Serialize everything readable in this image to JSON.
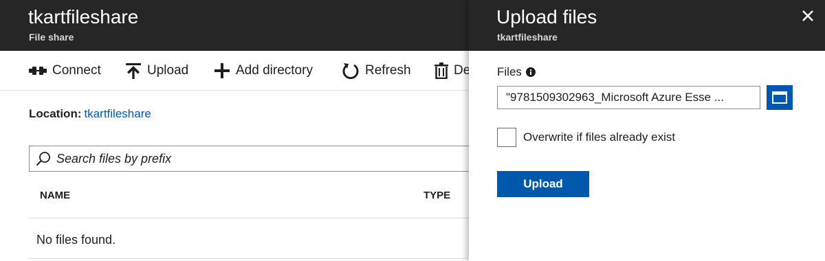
{
  "share_blade": {
    "title": "tkartfileshare",
    "subtitle": "File share",
    "toolbar": [
      {
        "label": "Connect",
        "icon": "connect-icon"
      },
      {
        "label": "Upload",
        "icon": "upload-icon"
      },
      {
        "label": "Add directory",
        "icon": "plus-icon"
      },
      {
        "label": "Refresh",
        "icon": "refresh-icon"
      },
      {
        "label": "De",
        "icon": "trash-icon"
      }
    ],
    "location": {
      "label": "Location:",
      "value": "tkartfileshare"
    },
    "search": {
      "placeholder": "Search files by prefix",
      "icon": "search-icon"
    },
    "table": {
      "columns": [
        "NAME",
        "TYPE"
      ],
      "empty_message": "No files found."
    }
  },
  "upload_blade": {
    "title": "Upload files",
    "subtitle": "tkartfileshare",
    "close_icon": "close-icon",
    "files_label": "Files",
    "files_value": "\"9781509302963_Microsoft Azure Esse ...",
    "browse_icon": "folder-icon",
    "overwrite_label": "Overwrite if files already exist",
    "overwrite_checked": false,
    "upload_button": "Upload"
  },
  "colors": {
    "header_bg": "#262626",
    "accent": "#0058ad",
    "link": "#0058ad"
  }
}
